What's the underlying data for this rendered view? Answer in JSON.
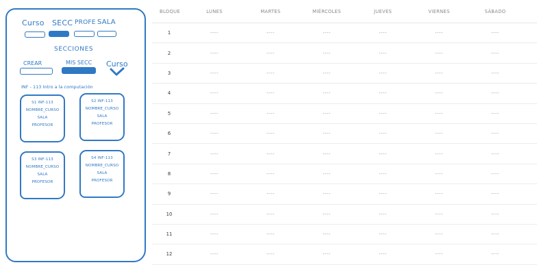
{
  "sidebar": {
    "tabs": [
      {
        "label": "Curso"
      },
      {
        "label": "SECC"
      },
      {
        "label": "PROFE"
      },
      {
        "label": "SALA"
      }
    ],
    "section_title": "SECCIONES",
    "sub_tabs": [
      {
        "label": "CREAR"
      },
      {
        "label": "MIS SECC"
      }
    ],
    "course_dropdown": "Curso",
    "course_heading": "INF - 113 Intro a la computación",
    "cards": [
      {
        "title": "S1 INF-113",
        "name": "NOMBRE_CURSO",
        "room": "SALA",
        "teacher": "PROFESOR"
      },
      {
        "title": "S2 INF-113",
        "name": "NOMBRE_CURSO",
        "room": "SALA",
        "teacher": "PROFESOR"
      },
      {
        "title": "S3 INF-113",
        "name": "NOMBRE_CURSO",
        "room": "SALA",
        "teacher": "PROFESOR"
      },
      {
        "title": "S4 INF-113",
        "name": "NOMBRE_CURSO",
        "room": "SALA",
        "teacher": "PROFESOR"
      }
    ]
  },
  "schedule": {
    "headers": [
      "BLOQUE",
      "LUNES",
      "MARTES",
      "MIÉRCOLES",
      "JUEVES",
      "VIERNES",
      "SÁBADO"
    ],
    "rows": [
      {
        "block": "1",
        "cells": [
          "----",
          "----",
          "----",
          "----",
          "----",
          "----"
        ]
      },
      {
        "block": "2",
        "cells": [
          "----",
          "----",
          "----",
          "----",
          "----",
          "----"
        ]
      },
      {
        "block": "3",
        "cells": [
          "----",
          "----",
          "----",
          "----",
          "----",
          "----"
        ]
      },
      {
        "block": "4",
        "cells": [
          "----",
          "----",
          "----",
          "----",
          "----",
          "----"
        ]
      },
      {
        "block": "5",
        "cells": [
          "----",
          "----",
          "----",
          "----",
          "----",
          "----"
        ]
      },
      {
        "block": "6",
        "cells": [
          "----",
          "----",
          "----",
          "----",
          "----",
          "----"
        ]
      },
      {
        "block": "7",
        "cells": [
          "----",
          "----",
          "----",
          "----",
          "----",
          "----"
        ]
      },
      {
        "block": "8",
        "cells": [
          "----",
          "----",
          "----",
          "----",
          "----",
          "----"
        ]
      },
      {
        "block": "9",
        "cells": [
          "----",
          "----",
          "----",
          "----",
          "----",
          "----"
        ]
      },
      {
        "block": "10",
        "cells": [
          "----",
          "----",
          "----",
          "----",
          "----",
          "----"
        ]
      },
      {
        "block": "11",
        "cells": [
          "----",
          "----",
          "----",
          "----",
          "----",
          "----"
        ]
      },
      {
        "block": "12",
        "cells": [
          "----",
          "----",
          "----",
          "----",
          "----",
          "----"
        ]
      }
    ]
  },
  "colors": {
    "accent": "#2f78c4",
    "grid_line": "#ececec",
    "muted_text": "#8a8a8a"
  }
}
